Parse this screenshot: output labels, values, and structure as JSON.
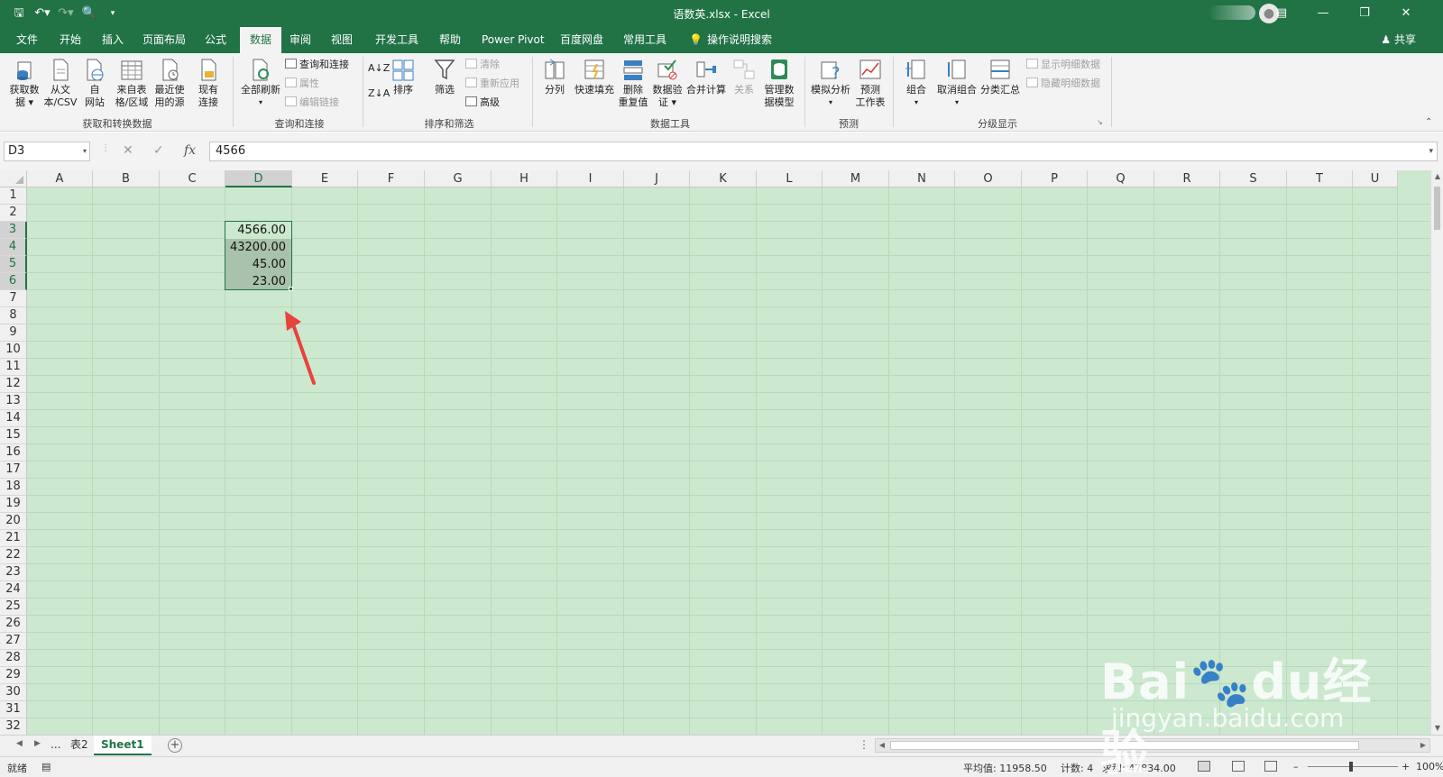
{
  "window": {
    "title": "语数英.xlsx  -  Excel"
  },
  "ribbon_tabs": [
    "文件",
    "开始",
    "插入",
    "页面布局",
    "公式",
    "数据",
    "审阅",
    "视图",
    "开发工具",
    "帮助",
    "Power Pivot",
    "百度网盘",
    "常用工具"
  ],
  "active_tab": "数据",
  "tell_me": "操作说明搜索",
  "share": "共享",
  "ribbon": {
    "get_data": "获取数\n据 ▾",
    "from_text": "从文\n本/CSV",
    "from_web": "自\n网站",
    "from_table": "来自表\n格/区域",
    "recent_sources": "最近使\n用的源",
    "existing": "现有\n连接",
    "group_get": "获取和转换数据",
    "refresh_all": "全部刷新",
    "queries": "查询和连接",
    "properties": "属性",
    "edit_links": "编辑链接",
    "group_queries": "查询和连接",
    "sort": "排序",
    "filter": "筛选",
    "clear": "清除",
    "reapply": "重新应用",
    "advanced": "高级",
    "group_sort": "排序和筛选",
    "text_to_cols": "分列",
    "flash_fill": "快速填充",
    "remove_dup": "删除\n重复值",
    "validation": "数据验\n证 ▾",
    "consolidate": "合并计算",
    "relations": "关系",
    "data_model": "管理数\n据模型",
    "group_tools": "数据工具",
    "what_if": "模拟分析",
    "forecast": "预测\n工作表",
    "group_forecast": "预测",
    "group_btn": "组合",
    "ungroup": "取消组合",
    "subtotal": "分类汇总",
    "show_detail": "显示明细数据",
    "hide_detail": "隐藏明细数据",
    "group_outline": "分级显示"
  },
  "name_box": "D3",
  "formula": "4566",
  "columns": [
    "A",
    "B",
    "C",
    "D",
    "E",
    "F",
    "G",
    "H",
    "I",
    "J",
    "K",
    "L",
    "M",
    "N",
    "O",
    "P",
    "Q",
    "R",
    "S",
    "T",
    "U"
  ],
  "rows": [
    "1",
    "2",
    "3",
    "4",
    "5",
    "6",
    "7",
    "8",
    "9",
    "10",
    "11",
    "12",
    "13",
    "14",
    "15",
    "16",
    "17",
    "18",
    "19",
    "20",
    "21",
    "22",
    "23",
    "24",
    "25",
    "26",
    "27",
    "28",
    "29",
    "30",
    "31",
    "32"
  ],
  "cells": [
    {
      "col": "D",
      "row": "3",
      "value": "4566.00"
    },
    {
      "col": "D",
      "row": "4",
      "value": "43200.00"
    },
    {
      "col": "D",
      "row": "5",
      "value": "45.00"
    },
    {
      "col": "D",
      "row": "6",
      "value": "23.00"
    }
  ],
  "sheet_tabs": [
    "表2",
    "Sheet1"
  ],
  "active_sheet": "Sheet1",
  "sheet_more": "...",
  "status": {
    "ready": "就绪",
    "average": "平均值: 11958.50",
    "count": "计数: 4",
    "sum": "求和: 47834.00",
    "zoom": "100%"
  },
  "watermark": {
    "brand": "Bai🐾du经验",
    "url": "jingyan.baidu.com"
  },
  "colors": {
    "accent": "#217346",
    "grid_bg": "#cce8cf",
    "range_bg": "#a9c2ab",
    "arrow": "#e8423d"
  }
}
